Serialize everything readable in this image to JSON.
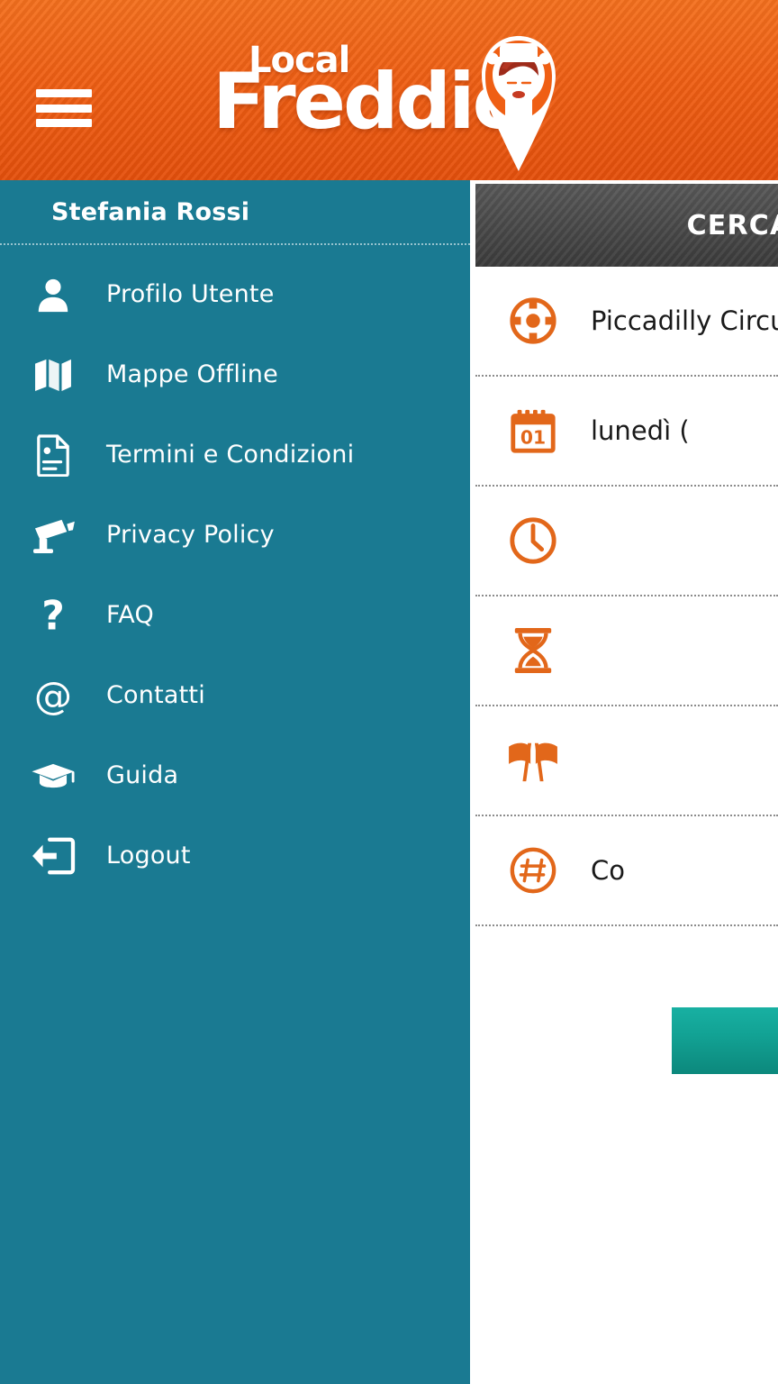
{
  "app": {
    "brand_primary_line": "Local",
    "brand_secondary_line": "Freddie",
    "header_color": "#ef5f14",
    "sidebar_color": "#1a7a92",
    "accent_orange": "#e2671a",
    "accent_teal": "#12a294"
  },
  "header": {
    "menu_button_label": "menu",
    "logo_top_text": "Local",
    "logo_main_text": "Freddie"
  },
  "sidebar": {
    "user_name": "Stefania Rossi",
    "items": [
      {
        "icon": "user-icon",
        "label": "Profilo Utente"
      },
      {
        "icon": "map-icon",
        "label": "Mappe Offline"
      },
      {
        "icon": "document-icon",
        "label": "Termini e Condizioni"
      },
      {
        "icon": "cctv-icon",
        "label": "Privacy Policy"
      },
      {
        "icon": "question-icon",
        "label": "FAQ"
      },
      {
        "icon": "at-icon",
        "label": "Contatti"
      },
      {
        "icon": "graduation-icon",
        "label": "Guida"
      },
      {
        "icon": "logout-icon",
        "label": "Logout"
      }
    ]
  },
  "panel": {
    "header_title": "CERCA",
    "rows": [
      {
        "icon": "target-icon",
        "label": "Piccadilly Circu"
      },
      {
        "icon": "calendar-icon",
        "label": "lunedì (",
        "calendar_day": "01"
      },
      {
        "icon": "clock-icon",
        "label": ""
      },
      {
        "icon": "hourglass-icon",
        "label": ""
      },
      {
        "icon": "flags-icon",
        "label": ""
      },
      {
        "icon": "hashtag-icon",
        "label": "Co"
      }
    ],
    "action_button_label": ""
  }
}
